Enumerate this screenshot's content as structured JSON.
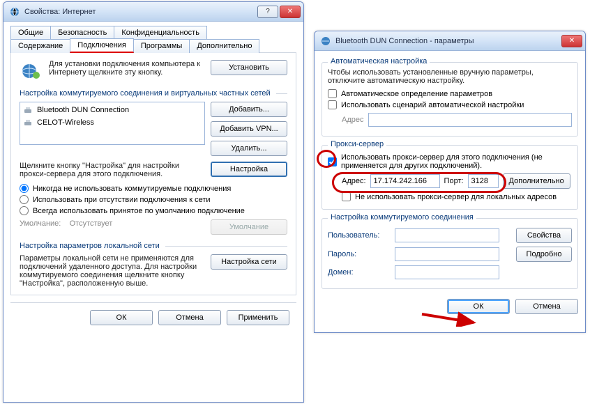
{
  "left_window": {
    "title": "Свойства: Интернет",
    "tabs_row1": [
      "Общие",
      "Безопасность",
      "Конфиденциальность"
    ],
    "tabs_row2": [
      "Содержание",
      "Подключения",
      "Программы",
      "Дополнительно"
    ],
    "active_tab": "Подключения",
    "setup_text": "Для установки подключения компьютера к Интернету щелкните эту кнопку.",
    "setup_btn": "Установить",
    "dial_section": "Настройка коммутируемого соединения и виртуальных частных сетей",
    "list": [
      "Bluetooth DUN Connection",
      "CELOT-Wireless"
    ],
    "btn_add": "Добавить...",
    "btn_add_vpn": "Добавить VPN...",
    "btn_remove": "Удалить...",
    "settings_hint": "Щелкните кнопку \"Настройка\" для настройки прокси-сервера для этого подключения.",
    "btn_settings": "Настройка",
    "radios": {
      "r1": "Никогда не использовать коммутируемые подключения",
      "r2": "Использовать при отсутствии подключения к сети",
      "r3": "Всегда использовать принятое по умолчанию подключение"
    },
    "default_label": "Умолчание:",
    "default_value": "Отсутствует",
    "btn_default": "Умолчание",
    "lan_section": "Настройка параметров локальной сети",
    "lan_hint": "Параметры локальной сети не применяются для подключений удаленного доступа. Для настройки коммутируемого соединения щелкните кнопку \"Настройка\", расположенную выше.",
    "btn_lan": "Настройка сети",
    "btn_ok": "ОК",
    "btn_cancel": "Отмена",
    "btn_apply": "Применить"
  },
  "right_window": {
    "title": "Bluetooth DUN Connection - параметры",
    "auto_group": "Автоматическая настройка",
    "auto_hint": "Чтобы использовать установленные вручную параметры, отключите автоматическую настройку.",
    "chk_auto_detect": "Автоматическое определение параметров",
    "chk_use_script": "Использовать сценарий автоматической настройки",
    "address_label": "Адрес",
    "proxy_group": "Прокси-сервер",
    "chk_use_proxy": "Использовать прокси-сервер для этого подключения (не применяется для других подключений).",
    "proxy_addr_label": "Адрес:",
    "proxy_addr": "17.174.242.166",
    "proxy_port_label": "Порт:",
    "proxy_port": "3128",
    "btn_advanced": "Дополнительно",
    "chk_bypass_local": "Не использовать прокси-сервер для локальных адресов",
    "dial_group": "Настройка коммутируемого соединения",
    "user_label": "Пользователь:",
    "pass_label": "Пароль:",
    "domain_label": "Домен:",
    "btn_props": "Свойства",
    "btn_more": "Подробно",
    "btn_ok": "ОК",
    "btn_cancel": "Отмена"
  }
}
